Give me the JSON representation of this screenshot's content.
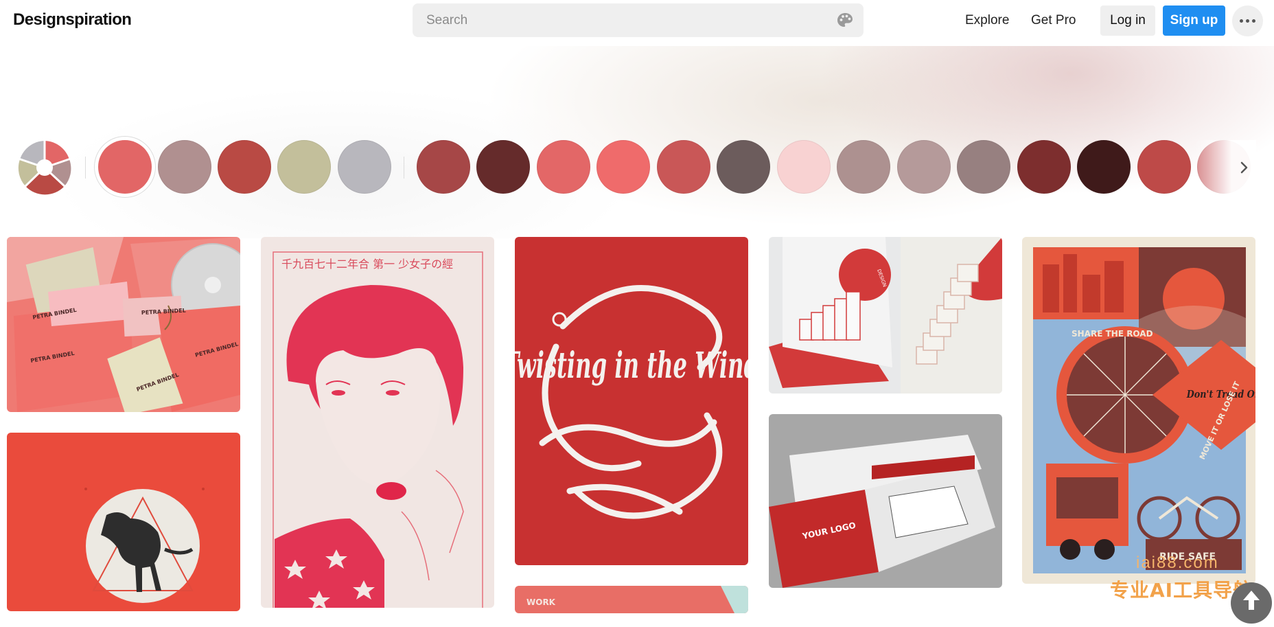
{
  "header": {
    "logo": "Designspiration",
    "search_placeholder": "Search",
    "nav": {
      "explore": "Explore",
      "get_pro": "Get Pro"
    },
    "login_label": "Log in",
    "signup_label": "Sign up"
  },
  "colors": {
    "accent_blue": "#1f8ef1",
    "selected_swatch": "#e26666",
    "primary_swatches": [
      "#e26666",
      "#b09090",
      "#b94a44",
      "#c3bf9b",
      "#b8b7bd"
    ],
    "related_swatches": [
      "#a64747",
      "#652b2b",
      "#e36767",
      "#ef6b6b",
      "#c95757",
      "#6c5c5c",
      "#f8d2d2",
      "#ad9190",
      "#b59a9a",
      "#978080",
      "#7d2e2e",
      "#3f1a1a",
      "#be4a48",
      "#d7888b"
    ]
  },
  "pins": [
    {
      "name": "petra-bindel-stationery",
      "text": [
        "PETRA BINDEL",
        "PETRA BINDEL",
        "PETRA BINDEL",
        "PETRA BINDEL",
        "PETRA BINDEL"
      ]
    },
    {
      "name": "dinosaur-poster"
    },
    {
      "name": "japanese-woman-illustration",
      "caption": "千九百七十二年合 第一 少女子の經"
    },
    {
      "name": "twisting-in-the-wind",
      "text": "Twisting in the Wind"
    },
    {
      "name": "work-card",
      "text": "WORK"
    },
    {
      "name": "popup-stairs-card",
      "text": "DESIGN"
    },
    {
      "name": "your-logo-brochure",
      "text": "YOUR LOGO"
    },
    {
      "name": "share-the-road-poster",
      "text": [
        "SHARE THE ROAD",
        "Don't Tread On Me",
        "MOVE IT OR LOSE IT",
        "RIDE SAFE"
      ]
    }
  ],
  "watermark": {
    "small": "iai88.com",
    "large": "专业AI工具导航"
  }
}
